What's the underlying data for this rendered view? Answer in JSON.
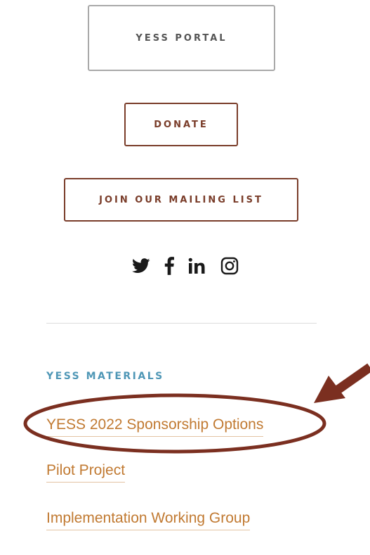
{
  "buttons": {
    "portal": "YESS PORTAL",
    "donate": "DONATE",
    "mailing_list": "JOIN OUR MAILING LIST"
  },
  "social_icons": [
    "twitter-icon",
    "facebook-icon",
    "linkedin-icon",
    "instagram-icon"
  ],
  "materials": {
    "heading": "YESS MATERIALS",
    "links": [
      "YESS 2022 Sponsorship Options",
      "Pilot Project",
      "Implementation Working Group"
    ]
  },
  "annotation": {
    "color": "#7b2f20"
  },
  "colors": {
    "accent_brown": "#7a3d2a",
    "link_orange": "#c17a32",
    "heading_blue": "#4f97b6"
  }
}
